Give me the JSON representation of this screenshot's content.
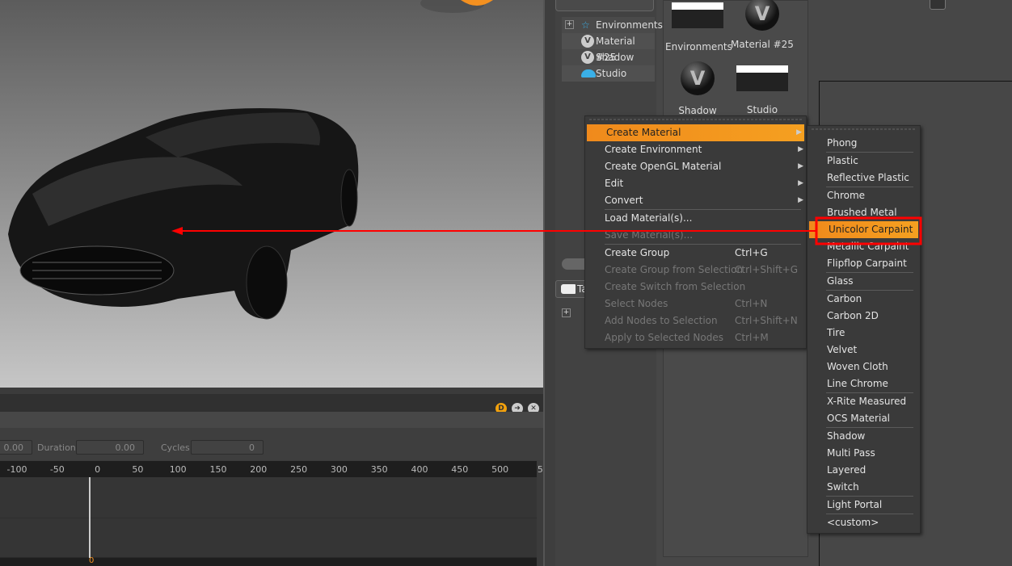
{
  "colors": {
    "accent": "#f39020",
    "annotation": "#ff0000",
    "background": "#474747"
  },
  "timeline": {
    "start_value": "0.00",
    "duration_label": "Duration",
    "duration_value": "0.00",
    "cycles_label": "Cycles",
    "cycles_value": "0",
    "ticks": [
      "-100",
      "-50",
      "0",
      "50",
      "100",
      "150",
      "200",
      "250",
      "300",
      "350",
      "400",
      "450",
      "500",
      "5"
    ],
    "current_frame": "0",
    "icons": [
      "d-badge-icon",
      "arrow-right-icon",
      "close-icon"
    ]
  },
  "tree": {
    "items": [
      {
        "label": "Environments",
        "icon": "environment-icon"
      },
      {
        "label": "Material #25",
        "icon": "material-v-icon"
      },
      {
        "label": "Shadow",
        "icon": "material-v-icon"
      },
      {
        "label": "Studio",
        "icon": "studio-env-icon"
      }
    ],
    "tab_label": "Ta"
  },
  "thumbnails": [
    {
      "label": "Environments"
    },
    {
      "label": "Material #25"
    },
    {
      "label": "Shadow"
    },
    {
      "label": "Studio"
    }
  ],
  "context_menu": {
    "items": [
      {
        "label": "Create Material",
        "submenu": true,
        "highlighted": true
      },
      {
        "label": "Create Environment",
        "submenu": true
      },
      {
        "label": "Create OpenGL Material",
        "submenu": true
      },
      {
        "label": "Edit",
        "submenu": true
      },
      {
        "label": "Convert",
        "submenu": true,
        "sep_after": true
      },
      {
        "label": "Load Material(s)..."
      },
      {
        "label": "Save Material(s)...",
        "disabled": true,
        "sep_after": true
      },
      {
        "label": "Create Group",
        "shortcut": "Ctrl+G"
      },
      {
        "label": "Create Group from Selection",
        "shortcut": "Ctrl+Shift+G",
        "disabled": true
      },
      {
        "label": "Create Switch from Selection",
        "disabled": true
      },
      {
        "label": "Select Nodes",
        "shortcut": "Ctrl+N",
        "disabled": true
      },
      {
        "label": "Add Nodes to Selection",
        "shortcut": "Ctrl+Shift+N",
        "disabled": true
      },
      {
        "label": "Apply to Selected Nodes",
        "shortcut": "Ctrl+M",
        "disabled": true
      }
    ]
  },
  "submenu": {
    "items": [
      {
        "label": "Phong",
        "sep_after": true
      },
      {
        "label": "Plastic"
      },
      {
        "label": "Reflective Plastic",
        "sep_after": true
      },
      {
        "label": "Chrome"
      },
      {
        "label": "Brushed Metal"
      },
      {
        "label": "Unicolor Carpaint",
        "highlighted": true
      },
      {
        "label": "Metallic Carpaint"
      },
      {
        "label": "Flipflop Carpaint",
        "sep_after": true
      },
      {
        "label": "Glass",
        "sep_after": true
      },
      {
        "label": "Carbon"
      },
      {
        "label": "Carbon 2D"
      },
      {
        "label": "Tire"
      },
      {
        "label": "Velvet"
      },
      {
        "label": "Woven Cloth"
      },
      {
        "label": "Line Chrome",
        "sep_after": true
      },
      {
        "label": "X-Rite Measured"
      },
      {
        "label": "OCS Material",
        "sep_after": true
      },
      {
        "label": "Shadow"
      },
      {
        "label": "Multi Pass"
      },
      {
        "label": "Layered"
      },
      {
        "label": "Switch",
        "sep_after": true
      },
      {
        "label": "Light Portal",
        "sep_after": true
      },
      {
        "label": "<custom>"
      }
    ]
  }
}
